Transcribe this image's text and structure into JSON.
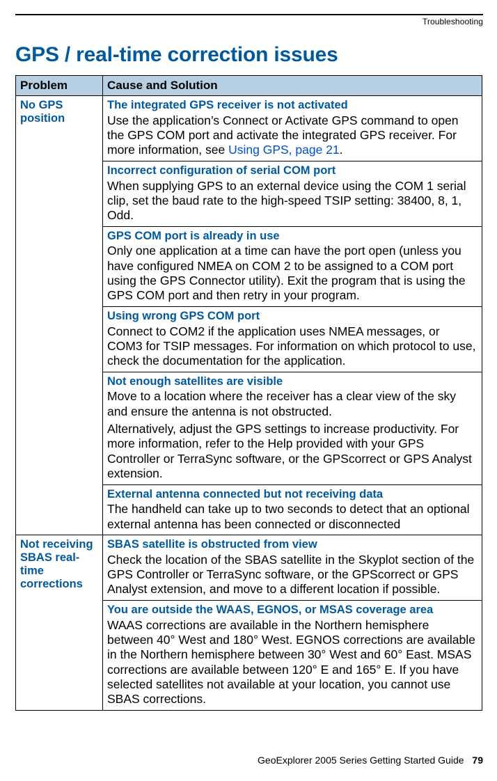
{
  "running_head": "Troubleshooting",
  "title": "GPS / real-time correction issues",
  "thead": {
    "problem": "Problem",
    "solution": "Cause and Solution"
  },
  "problems": [
    {
      "label": "No GPS position",
      "causes": [
        {
          "title": "The integrated GPS receiver is not activated",
          "body_pre": "Use the application’s Connect or Activate GPS command to open the GPS COM port and activate the integrated GPS receiver. For more information, see ",
          "link": "Using GPS, page 21",
          "body_post": "."
        },
        {
          "title": "Incorrect configuration of serial COM port",
          "body": "When supplying GPS to an external device using the COM 1 serial clip, set the baud rate to the high-speed TSIP setting: 38400, 8, 1, Odd."
        },
        {
          "title": "GPS COM port is already in use",
          "body": "Only one application at a time can have the port open (unless you have configured NMEA on COM 2 to be assigned to a COM port using the GPS Connector utility). Exit the program that is using the GPS COM port and then retry in your program."
        },
        {
          "title": "Using wrong GPS COM port",
          "body": "Connect to COM2 if the application uses NMEA messages, or COM3 for TSIP messages. For information on which protocol to use, check the documentation for the application."
        },
        {
          "title": "Not enough satellites are visible",
          "body_p1": "Move to a location where the receiver has a clear view of the sky and ensure the antenna is not obstructed.",
          "body_p2": "Alternatively, adjust the GPS settings to increase productivity. For more information, refer to the Help provided with your GPS Controller or TerraSync software, or the GPScorrect or GPS Analyst extension."
        },
        {
          "title": "External antenna connected but not receiving data",
          "body": "The handheld can take up to two seconds to detect that an optional external antenna has been connected or disconnected"
        }
      ]
    },
    {
      "label": "Not receiving SBAS real-time corrections",
      "causes": [
        {
          "title": "SBAS satellite is obstructed from view",
          "body": "Check the location of the SBAS satellite in the Skyplot section of the GPS Controller or TerraSync software, or the GPScorrect or GPS Analyst extension, and move to a different location if possible."
        },
        {
          "title": "You are outside the WAAS, EGNOS, or MSAS coverage area",
          "body": "WAAS corrections are available in the Northern hemisphere between 40° West and 180° West. EGNOS corrections are available in the Northern hemisphere between 30° West and 60° East. MSAS corrections are available between 120° E and 165° E. If you have selected satellites not available at your location, you cannot use SBAS corrections."
        }
      ]
    }
  ],
  "footer": {
    "guide": "GeoExplorer 2005 Series Getting Started Guide",
    "page": "79"
  }
}
